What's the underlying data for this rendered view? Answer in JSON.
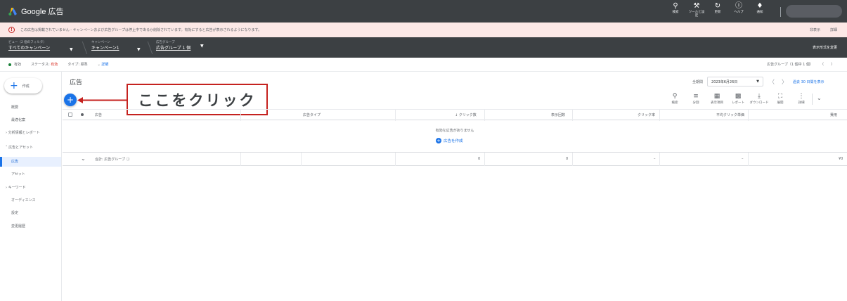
{
  "header": {
    "app_title": "Google 広告",
    "actions": [
      {
        "label": "検索",
        "icon": "search-icon"
      },
      {
        "label": "ツールと設定",
        "icon": "wrench-icon"
      },
      {
        "label": "更新",
        "icon": "refresh-icon"
      },
      {
        "label": "ヘルプ",
        "icon": "help-icon"
      },
      {
        "label": "通知",
        "icon": "bell-icon"
      }
    ]
  },
  "alert": {
    "text": "この広告は掲載されていません - キャンペーンおよび広告グループは停止中であるか削除されています。有効にすると広告が表示されるようになります。",
    "dismiss": "非表示",
    "details": "詳細"
  },
  "scope": {
    "view_small": "ビュー（2 個のフィルタ）",
    "view_big": "すべてのキャンペーン",
    "campaign_small": "キャンペーン",
    "campaign_big": "キャンペーン1",
    "adgroup_small": "広告グループ",
    "adgroup_big": "広告グループ 1 個",
    "view_change": "表示形式を変更"
  },
  "filters": {
    "active": "有効",
    "status_label": "ステータス:",
    "status_value": "有効",
    "type": "タイプ: 標準",
    "details": "詳細",
    "adgroup_count": "広告グループ（1 個中 1 個）"
  },
  "nav": {
    "create_label": "作成",
    "items": [
      {
        "label": "概要"
      },
      {
        "label": "最適化案"
      },
      {
        "label": "分析情報とレポート"
      },
      {
        "label": "広告とアセット"
      },
      {
        "label": "広告"
      },
      {
        "label": "アセット"
      },
      {
        "label": "キーワード"
      },
      {
        "label": "オーディエンス"
      },
      {
        "label": "設定"
      },
      {
        "label": "変更履歴"
      }
    ]
  },
  "main": {
    "title": "広告",
    "period_label": "全期間",
    "period_value": "2023年6月26日",
    "period_link": "過去 30 日間を表示",
    "callout": "ここをクリック",
    "tools": [
      {
        "label": "検索",
        "icon": "search-icon"
      },
      {
        "label": "分割",
        "icon": "segment-icon"
      },
      {
        "label": "表示項目",
        "icon": "columns-icon"
      },
      {
        "label": "レポート",
        "icon": "report-icon"
      },
      {
        "label": "ダウンロード",
        "icon": "download-icon"
      },
      {
        "label": "展開",
        "icon": "expand-icon"
      },
      {
        "label": "詳細",
        "icon": "more-icon"
      }
    ]
  },
  "table": {
    "headers": {
      "ad": "広告",
      "ad_type": "広告タイプ",
      "clicks": "↓ クリック数",
      "impressions": "表示回数",
      "ctr": "クリック率",
      "avg_cpc": "平均クリック単価",
      "cost": "費用"
    },
    "empty_message": "有効な広告がありません",
    "create_ad": "広告を作成",
    "total": {
      "label": "合計: 広告グループ",
      "clicks": "0",
      "impressions": "0",
      "ctr": "–",
      "avg_cpc": "–",
      "cost": "¥0"
    }
  },
  "colors": {
    "header_bg": "#3c4043",
    "accent": "#1a73e8",
    "alert_bg": "#fce8e6",
    "callout_border": "#c5221f"
  }
}
